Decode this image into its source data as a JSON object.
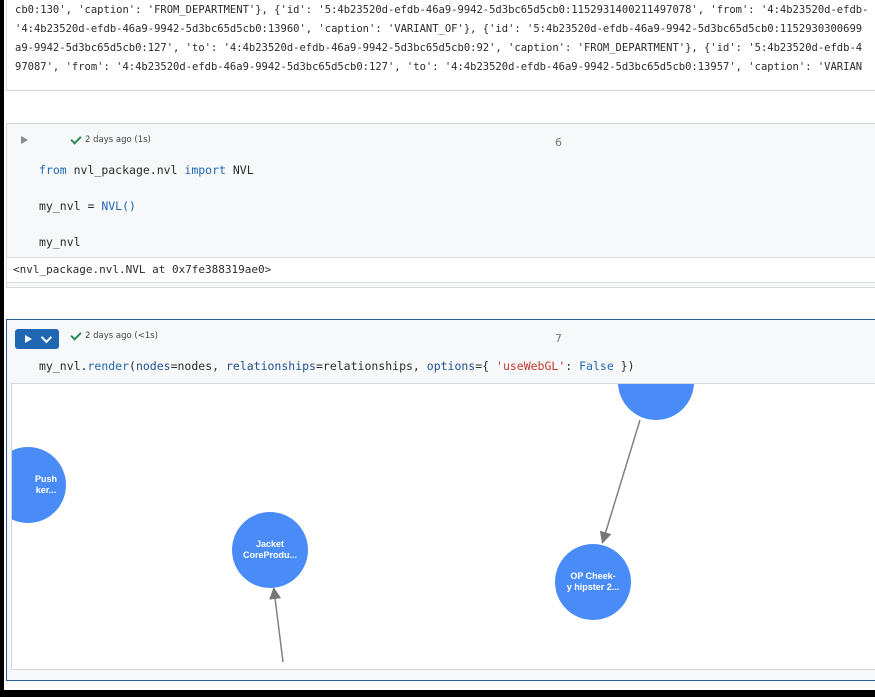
{
  "output_top": {
    "lines": [
      "cb0:130', 'caption': 'FROM_DEPARTMENT'}, {'id': '5:4b23520d-efdb-46a9-9942-5d3bc65d5cb0:1152931400211497078', 'from': '4:4b23520d-efdb-",
      "'4:4b23520d-efdb-46a9-9942-5d3bc65d5cb0:13960', 'caption': 'VARIANT_OF'}, {'id': '5:4b23520d-efdb-46a9-9942-5d3bc65d5cb0:1152930300699",
      "a9-9942-5d3bc65d5cb0:127', 'to': '4:4b23520d-efdb-46a9-9942-5d3bc65d5cb0:92', 'caption': 'FROM_DEPARTMENT'}, {'id': '5:4b23520d-efdb-4",
      "97087', 'from': '4:4b23520d-efdb-46a9-9942-5d3bc65d5cb0:127', 'to': '4:4b23520d-efdb-46a9-9942-5d3bc65d5cb0:13957', 'caption': 'VARIAN"
    ]
  },
  "cell6": {
    "status": "2 days ago (1s)",
    "number": "6",
    "code": {
      "line1_kw1": "from",
      "line1_mod": " nvl_package.nvl ",
      "line1_kw2": "import",
      "line1_name": " NVL",
      "line2_var": "my_nvl = ",
      "line2_fn": "NVL()",
      "line3": "my_nvl"
    },
    "result": "<nvl_package.nvl.NVL at 0x7fe388319ae0>"
  },
  "cell7": {
    "status": "2 days ago (<1s)",
    "number": "7",
    "code": {
      "obj": "my_nvl.",
      "fn": "render",
      "p1": "(",
      "k1": "nodes",
      "p2": "=nodes, ",
      "k2": "relationships",
      "p3": "=relationships, ",
      "k3": "options",
      "p4": "={ ",
      "s1": "'useWebGL'",
      "p5": ": ",
      "b1": "False",
      "p6": " })"
    }
  },
  "graph": {
    "node_color": "#4a8cf7",
    "nodes": [
      {
        "id": "push",
        "label1": "Push",
        "label2": "ker..."
      },
      {
        "id": "jacket",
        "label1": "Jacket",
        "label2": "CoreProdu..."
      },
      {
        "id": "opcheek",
        "label1": "OP Cheek-",
        "label2": "y hipster 2..."
      },
      {
        "id": "top",
        "label1": "",
        "label2": ""
      }
    ]
  },
  "colors": {
    "accent": "#1f67b3",
    "check": "#2e8b57",
    "background": "#000000"
  }
}
